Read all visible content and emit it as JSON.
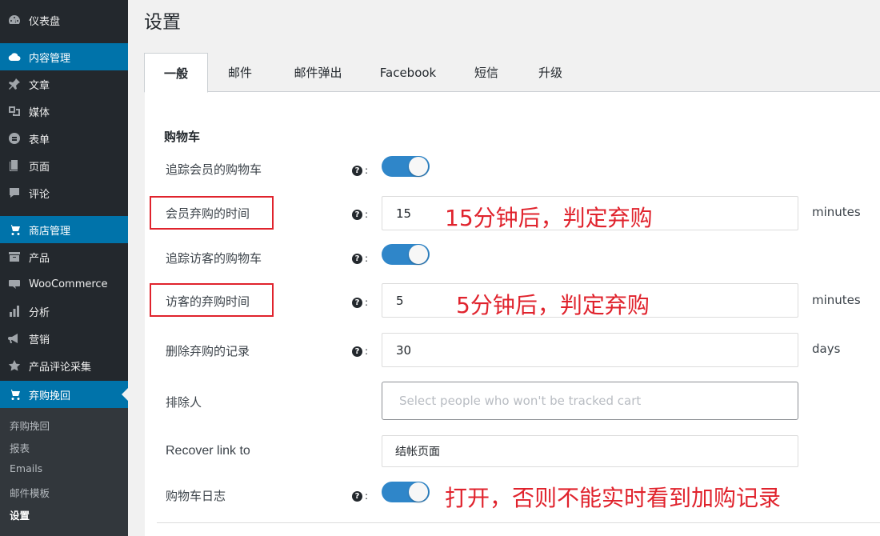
{
  "sidebar": {
    "items": [
      {
        "label": "仪表盘",
        "icon": "dashboard-icon"
      },
      {
        "label": "内容管理",
        "icon": "cloud-icon"
      },
      {
        "label": "文章",
        "icon": "pin-icon"
      },
      {
        "label": "媒体",
        "icon": "media-icon"
      },
      {
        "label": "表单",
        "icon": "form-icon"
      },
      {
        "label": "页面",
        "icon": "page-icon"
      },
      {
        "label": "评论",
        "icon": "comment-icon"
      },
      {
        "label": "商店管理",
        "icon": "cart-icon"
      },
      {
        "label": "产品",
        "icon": "archive-icon"
      },
      {
        "label": "WooCommerce",
        "icon": "woo-icon"
      },
      {
        "label": "分析",
        "icon": "chart-icon"
      },
      {
        "label": "营销",
        "icon": "megaphone-icon"
      },
      {
        "label": "产品评论采集",
        "icon": "star-icon"
      },
      {
        "label": "弃购挽回",
        "icon": "cart-icon"
      }
    ],
    "submenu": [
      "弃购挽回",
      "报表",
      "Emails",
      "邮件模板",
      "设置"
    ]
  },
  "page": {
    "title": "设置"
  },
  "tabs": [
    "一般",
    "邮件",
    "邮件弹出",
    "Facebook",
    "短信",
    "升级"
  ],
  "section": {
    "title": "购物车"
  },
  "fields": {
    "track_member": {
      "label": "追踪会员的购物车",
      "enabled": true
    },
    "member_time": {
      "label": "会员弃购的时间",
      "value": "15",
      "unit": "minutes"
    },
    "track_guest": {
      "label": "追踪访客的购物车",
      "enabled": true
    },
    "guest_time": {
      "label": "访客的弃购时间",
      "value": "5",
      "unit": "minutes"
    },
    "delete_records": {
      "label": "删除弃购的记录",
      "value": "30",
      "unit": "days"
    },
    "exclude": {
      "label": "排除人",
      "placeholder": "Select people who won't be tracked cart"
    },
    "recover_link": {
      "label": "Recover link to",
      "value": "结帐页面"
    },
    "cart_log": {
      "label": "购物车日志",
      "enabled": true
    }
  },
  "help_suffix": ":",
  "annotations": {
    "a1": "15分钟后，判定弃购",
    "a2": "5分钟后，判定弃购",
    "a3": "打开，否则不能实时看到加购记录"
  },
  "colors": {
    "sidebar": "#23282d",
    "accent": "#0073aa",
    "toggle": "#2f86c9",
    "annotation": "#e0232d"
  }
}
